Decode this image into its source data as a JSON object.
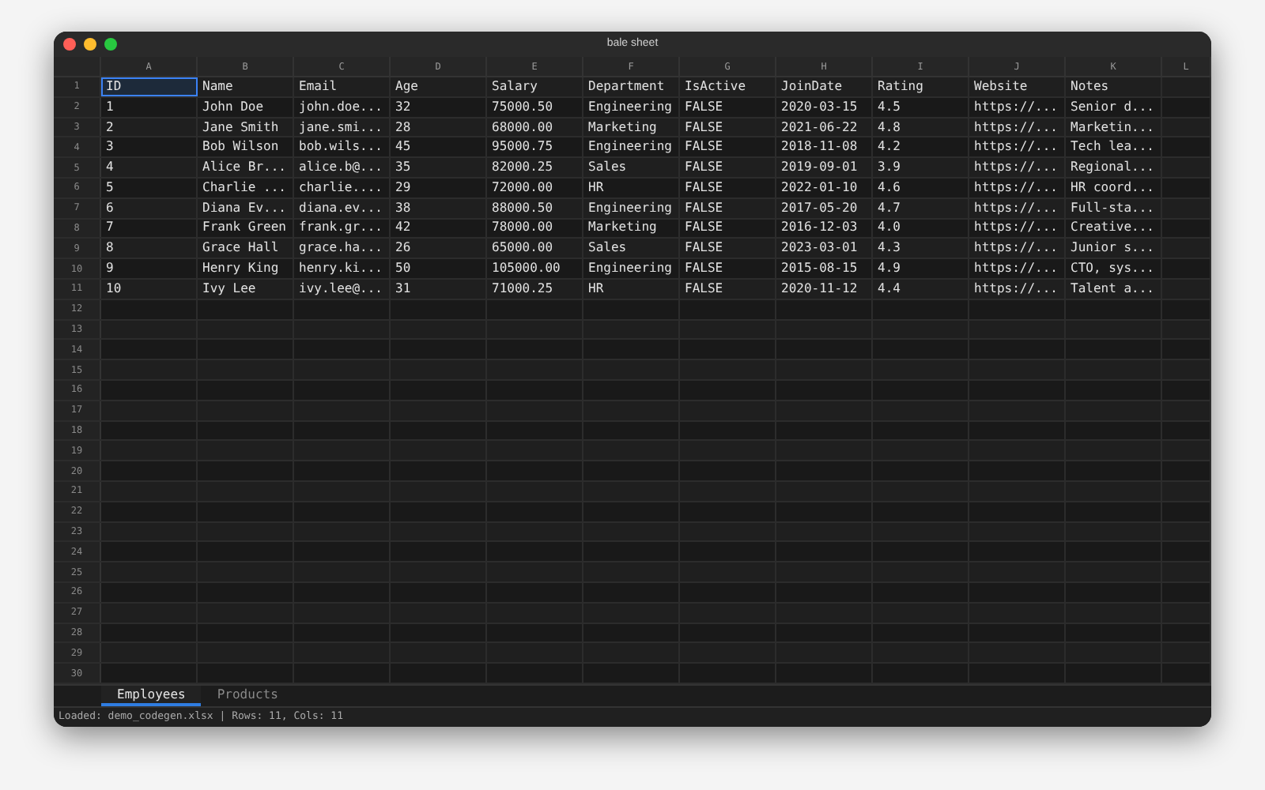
{
  "window": {
    "title": "bale sheet"
  },
  "columns": [
    "A",
    "B",
    "C",
    "D",
    "E",
    "F",
    "G",
    "H",
    "I",
    "J",
    "K",
    "L"
  ],
  "rows": [
    {
      "number": "1",
      "cells": [
        {
          "text": "ID",
          "selected": true
        },
        {
          "text": "Name",
          "selected": false
        },
        {
          "text": "Email",
          "selected": false
        },
        {
          "text": "Age",
          "selected": false
        },
        {
          "text": "Salary",
          "selected": false
        },
        {
          "text": "Department",
          "selected": false
        },
        {
          "text": "IsActive",
          "selected": false
        },
        {
          "text": "JoinDate",
          "selected": false
        },
        {
          "text": "Rating",
          "selected": false
        },
        {
          "text": "Website",
          "selected": false
        },
        {
          "text": "Notes",
          "selected": false
        }
      ]
    },
    {
      "number": "2",
      "cells": [
        {
          "text": "1",
          "selected": false
        },
        {
          "text": "John Doe",
          "selected": false
        },
        {
          "text": "john.doe...",
          "selected": false
        },
        {
          "text": "32",
          "selected": false
        },
        {
          "text": "75000.50",
          "selected": false
        },
        {
          "text": "Engineering",
          "selected": false
        },
        {
          "text": "FALSE",
          "selected": false
        },
        {
          "text": "2020-03-15",
          "selected": false
        },
        {
          "text": "4.5",
          "selected": false
        },
        {
          "text": "https://...",
          "selected": false
        },
        {
          "text": "Senior d...",
          "selected": false
        }
      ]
    },
    {
      "number": "3",
      "cells": [
        {
          "text": "2",
          "selected": false
        },
        {
          "text": "Jane Smith",
          "selected": false
        },
        {
          "text": "jane.smi...",
          "selected": false
        },
        {
          "text": "28",
          "selected": false
        },
        {
          "text": "68000.00",
          "selected": false
        },
        {
          "text": "Marketing",
          "selected": false
        },
        {
          "text": "FALSE",
          "selected": false
        },
        {
          "text": "2021-06-22",
          "selected": false
        },
        {
          "text": "4.8",
          "selected": false
        },
        {
          "text": "https://...",
          "selected": false
        },
        {
          "text": "Marketin...",
          "selected": false
        }
      ]
    },
    {
      "number": "4",
      "cells": [
        {
          "text": "3",
          "selected": false
        },
        {
          "text": "Bob Wilson",
          "selected": false
        },
        {
          "text": "bob.wils...",
          "selected": false
        },
        {
          "text": "45",
          "selected": false
        },
        {
          "text": "95000.75",
          "selected": false
        },
        {
          "text": "Engineering",
          "selected": false
        },
        {
          "text": "FALSE",
          "selected": false
        },
        {
          "text": "2018-11-08",
          "selected": false
        },
        {
          "text": "4.2",
          "selected": false
        },
        {
          "text": "https://...",
          "selected": false
        },
        {
          "text": "Tech lea...",
          "selected": false
        }
      ]
    },
    {
      "number": "5",
      "cells": [
        {
          "text": "4",
          "selected": false
        },
        {
          "text": "Alice Br...",
          "selected": false
        },
        {
          "text": "alice.b@...",
          "selected": false
        },
        {
          "text": "35",
          "selected": false
        },
        {
          "text": "82000.25",
          "selected": false
        },
        {
          "text": "Sales",
          "selected": false
        },
        {
          "text": "FALSE",
          "selected": false
        },
        {
          "text": "2019-09-01",
          "selected": false
        },
        {
          "text": "3.9",
          "selected": false
        },
        {
          "text": "https://...",
          "selected": false
        },
        {
          "text": "Regional...",
          "selected": false
        }
      ]
    },
    {
      "number": "6",
      "cells": [
        {
          "text": "5",
          "selected": false
        },
        {
          "text": "Charlie ...",
          "selected": false
        },
        {
          "text": "charlie....",
          "selected": false
        },
        {
          "text": "29",
          "selected": false
        },
        {
          "text": "72000.00",
          "selected": false
        },
        {
          "text": "HR",
          "selected": false
        },
        {
          "text": "FALSE",
          "selected": false
        },
        {
          "text": "2022-01-10",
          "selected": false
        },
        {
          "text": "4.6",
          "selected": false
        },
        {
          "text": "https://...",
          "selected": false
        },
        {
          "text": "HR coord...",
          "selected": false
        }
      ]
    },
    {
      "number": "7",
      "cells": [
        {
          "text": "6",
          "selected": false
        },
        {
          "text": "Diana Ev...",
          "selected": false
        },
        {
          "text": "diana.ev...",
          "selected": false
        },
        {
          "text": "38",
          "selected": false
        },
        {
          "text": "88000.50",
          "selected": false
        },
        {
          "text": "Engineering",
          "selected": false
        },
        {
          "text": "FALSE",
          "selected": false
        },
        {
          "text": "2017-05-20",
          "selected": false
        },
        {
          "text": "4.7",
          "selected": false
        },
        {
          "text": "https://...",
          "selected": false
        },
        {
          "text": "Full-sta...",
          "selected": false
        }
      ]
    },
    {
      "number": "8",
      "cells": [
        {
          "text": "7",
          "selected": false
        },
        {
          "text": "Frank Green",
          "selected": false
        },
        {
          "text": "frank.gr...",
          "selected": false
        },
        {
          "text": "42",
          "selected": false
        },
        {
          "text": "78000.00",
          "selected": false
        },
        {
          "text": "Marketing",
          "selected": false
        },
        {
          "text": "FALSE",
          "selected": false
        },
        {
          "text": "2016-12-03",
          "selected": false
        },
        {
          "text": "4.0",
          "selected": false
        },
        {
          "text": "https://...",
          "selected": false
        },
        {
          "text": "Creative...",
          "selected": false
        }
      ]
    },
    {
      "number": "9",
      "cells": [
        {
          "text": "8",
          "selected": false
        },
        {
          "text": "Grace Hall",
          "selected": false
        },
        {
          "text": "grace.ha...",
          "selected": false
        },
        {
          "text": "26",
          "selected": false
        },
        {
          "text": "65000.00",
          "selected": false
        },
        {
          "text": "Sales",
          "selected": false
        },
        {
          "text": "FALSE",
          "selected": false
        },
        {
          "text": "2023-03-01",
          "selected": false
        },
        {
          "text": "4.3",
          "selected": false
        },
        {
          "text": "https://...",
          "selected": false
        },
        {
          "text": "Junior s...",
          "selected": false
        }
      ]
    },
    {
      "number": "10",
      "cells": [
        {
          "text": "9",
          "selected": false
        },
        {
          "text": "Henry King",
          "selected": false
        },
        {
          "text": "henry.ki...",
          "selected": false
        },
        {
          "text": "50",
          "selected": false
        },
        {
          "text": "105000.00",
          "selected": false
        },
        {
          "text": "Engineering",
          "selected": false
        },
        {
          "text": "FALSE",
          "selected": false
        },
        {
          "text": "2015-08-15",
          "selected": false
        },
        {
          "text": "4.9",
          "selected": false
        },
        {
          "text": "https://...",
          "selected": false
        },
        {
          "text": "CTO, sys...",
          "selected": false
        }
      ]
    },
    {
      "number": "11",
      "cells": [
        {
          "text": "10",
          "selected": false
        },
        {
          "text": "Ivy Lee",
          "selected": false
        },
        {
          "text": "ivy.lee@...",
          "selected": false
        },
        {
          "text": "31",
          "selected": false
        },
        {
          "text": "71000.25",
          "selected": false
        },
        {
          "text": "HR",
          "selected": false
        },
        {
          "text": "FALSE",
          "selected": false
        },
        {
          "text": "2020-11-12",
          "selected": false
        },
        {
          "text": "4.4",
          "selected": false
        },
        {
          "text": "https://...",
          "selected": false
        },
        {
          "text": "Talent a...",
          "selected": false
        }
      ]
    },
    {
      "number": "12"
    },
    {
      "number": "13"
    },
    {
      "number": "14"
    },
    {
      "number": "15"
    },
    {
      "number": "16"
    },
    {
      "number": "17"
    },
    {
      "number": "18"
    },
    {
      "number": "19"
    },
    {
      "number": "20"
    },
    {
      "number": "21"
    },
    {
      "number": "22"
    },
    {
      "number": "23"
    },
    {
      "number": "24"
    },
    {
      "number": "25"
    },
    {
      "number": "26"
    },
    {
      "number": "27"
    },
    {
      "number": "28"
    },
    {
      "number": "29"
    },
    {
      "number": "30"
    }
  ],
  "sheet_tabs": [
    {
      "label": "Employees",
      "selected": true
    },
    {
      "label": "Products",
      "selected": false
    }
  ],
  "status_bar": "Loaded: demo_codegen.xlsx | Rows: 11, Cols: 11"
}
